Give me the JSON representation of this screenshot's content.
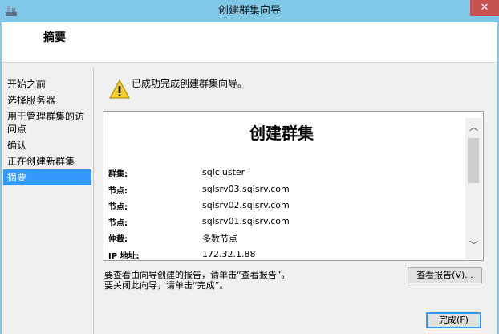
{
  "window": {
    "title": "创建群集向导",
    "close_glyph": "✕"
  },
  "header": {
    "title": "摘要"
  },
  "nav": {
    "items": [
      {
        "label": "开始之前",
        "active": false
      },
      {
        "label": "选择服务器",
        "active": false
      },
      {
        "label": "用于管理群集的访问点",
        "active": false
      },
      {
        "label": "确认",
        "active": false
      },
      {
        "label": "正在创建新群集",
        "active": false
      },
      {
        "label": "摘要",
        "active": true
      }
    ]
  },
  "status": {
    "message": "已成功完成创建群集向导。",
    "icon": "warning-icon"
  },
  "report": {
    "title": "创建群集",
    "rows": [
      {
        "label": "群集:",
        "value": "sqlcluster"
      },
      {
        "label": "节点:",
        "value": "sqlsrv03.sqlsrv.com"
      },
      {
        "label": "节点:",
        "value": "sqlsrv02.sqlsrv.com"
      },
      {
        "label": "节点:",
        "value": "sqlsrv01.sqlsrv.com"
      },
      {
        "label": "仲裁:",
        "value": "多数节点"
      },
      {
        "label": "IP 地址:",
        "value": "172.32.1.88"
      }
    ]
  },
  "scrollbar": {
    "up_glyph": "︿",
    "down_glyph": "﹀"
  },
  "hints": {
    "view_report": "要查看由向导创建的报告，请单击“查看报告”。",
    "close_wizard": "要关闭此向导，请单击“完成”。"
  },
  "buttons": {
    "view_report": "查看报告(V)...",
    "finish": "完成(F)"
  },
  "colors": {
    "titlebar": "#7fc8e8",
    "nav_active": "#3399ff",
    "close_button": "#c75050"
  }
}
